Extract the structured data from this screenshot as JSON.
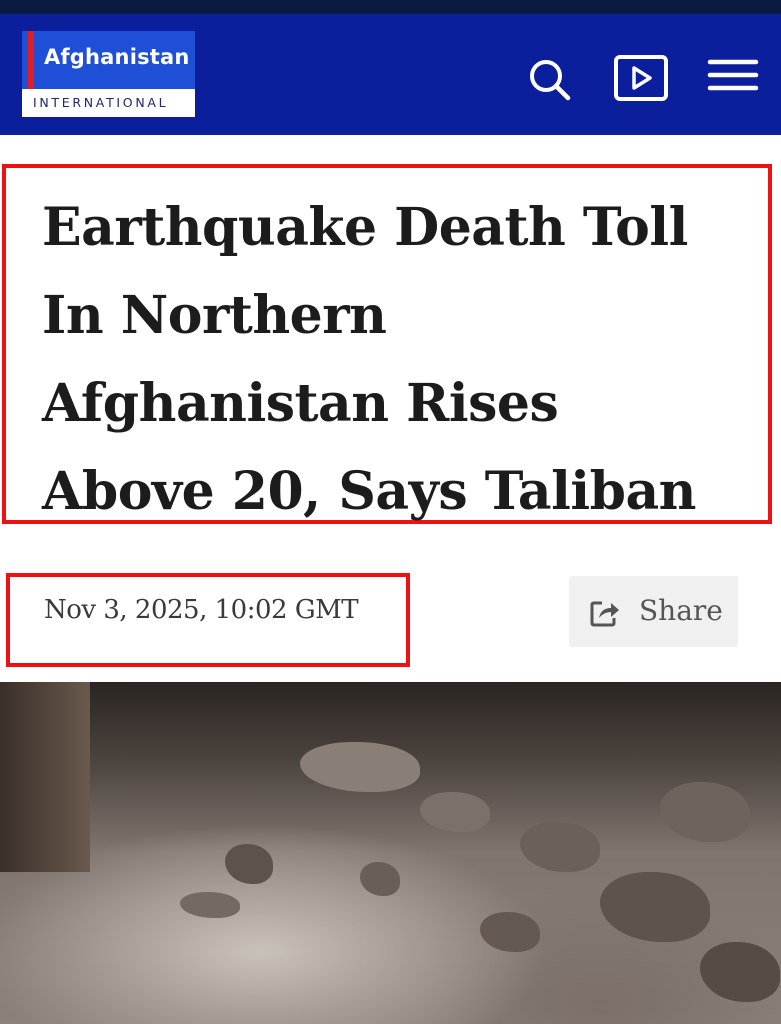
{
  "header": {
    "logo": {
      "word": "Afghanistan",
      "sub": "INTERNATIONAL"
    },
    "icons": [
      "search-icon",
      "video-play-icon",
      "menu-icon"
    ],
    "background_color": "#0b1f9c"
  },
  "article": {
    "title": "Earthquake Death Toll In Northern Afghanistan Rises Above 20, Says Taliban",
    "date": "Nov 3, 2025, 10:02 GMT",
    "share_label": "Share"
  },
  "highlight_color": "#ee1111",
  "photo": {
    "description_icon": "earthquake-rubble-photo"
  }
}
